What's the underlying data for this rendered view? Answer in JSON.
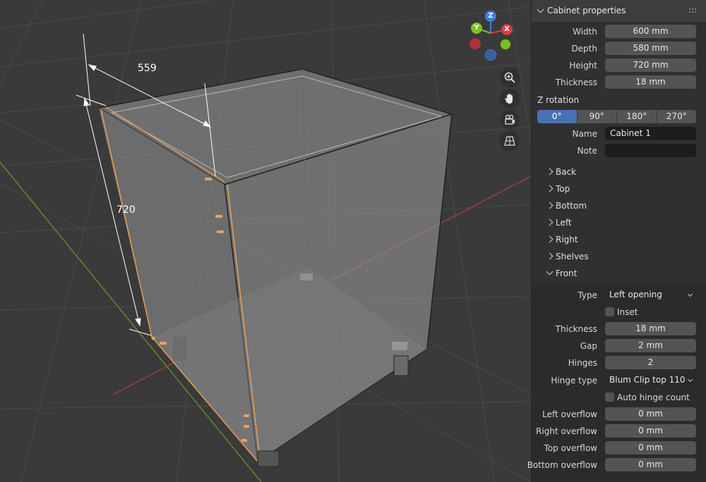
{
  "viewport": {
    "dimension_width": "559",
    "dimension_height": "720",
    "gizmo": {
      "z": "Z",
      "y": "Y",
      "x": "X"
    },
    "tools": [
      "zoom-icon",
      "hand-pan-icon",
      "camera-icon",
      "perspective-grid-icon"
    ]
  },
  "panel": {
    "title": "Cabinet properties",
    "fields": [
      {
        "label": "Width",
        "value": "600 mm"
      },
      {
        "label": "Depth",
        "value": "580 mm"
      },
      {
        "label": "Height",
        "value": "720 mm"
      },
      {
        "label": "Thickness",
        "value": "18 mm"
      }
    ],
    "z_rotation": {
      "label": "Z rotation",
      "options": [
        "0°",
        "90°",
        "180°",
        "270°"
      ],
      "selected": "0°"
    },
    "name": {
      "label": "Name",
      "value": "Cabinet 1"
    },
    "note": {
      "label": "Note",
      "value": ""
    },
    "sections": [
      {
        "label": "Back",
        "expanded": false
      },
      {
        "label": "Top",
        "expanded": false
      },
      {
        "label": "Bottom",
        "expanded": false
      },
      {
        "label": "Left",
        "expanded": false
      },
      {
        "label": "Right",
        "expanded": false
      },
      {
        "label": "Shelves",
        "expanded": false
      },
      {
        "label": "Front",
        "expanded": true
      }
    ],
    "front": {
      "type": {
        "label": "Type",
        "value": "Left opening"
      },
      "inset": {
        "label": "Inset",
        "checked": false
      },
      "thickness": {
        "label": "Thickness",
        "value": "18 mm"
      },
      "gap": {
        "label": "Gap",
        "value": "2 mm"
      },
      "hinges": {
        "label": "Hinges",
        "value": "2"
      },
      "hinge_type": {
        "label": "Hinge type",
        "value": "Blum Clip top 110"
      },
      "auto_hinge_count": {
        "label": "Auto hinge count",
        "checked": false
      },
      "left_overflow": {
        "label": "Left overflow",
        "value": "0 mm"
      },
      "right_overflow": {
        "label": "Right overflow",
        "value": "0 mm"
      },
      "top_overflow": {
        "label": "Top overflow",
        "value": "0 mm"
      },
      "bottom_overflow": {
        "label": "Bottom overflow",
        "value": "0 mm"
      }
    }
  },
  "colors": {
    "accent": "#4772b3",
    "selection": "#f0a050",
    "axis_x": "#e0384a",
    "axis_y": "#7cbf2a",
    "axis_z": "#3c7ee0"
  }
}
